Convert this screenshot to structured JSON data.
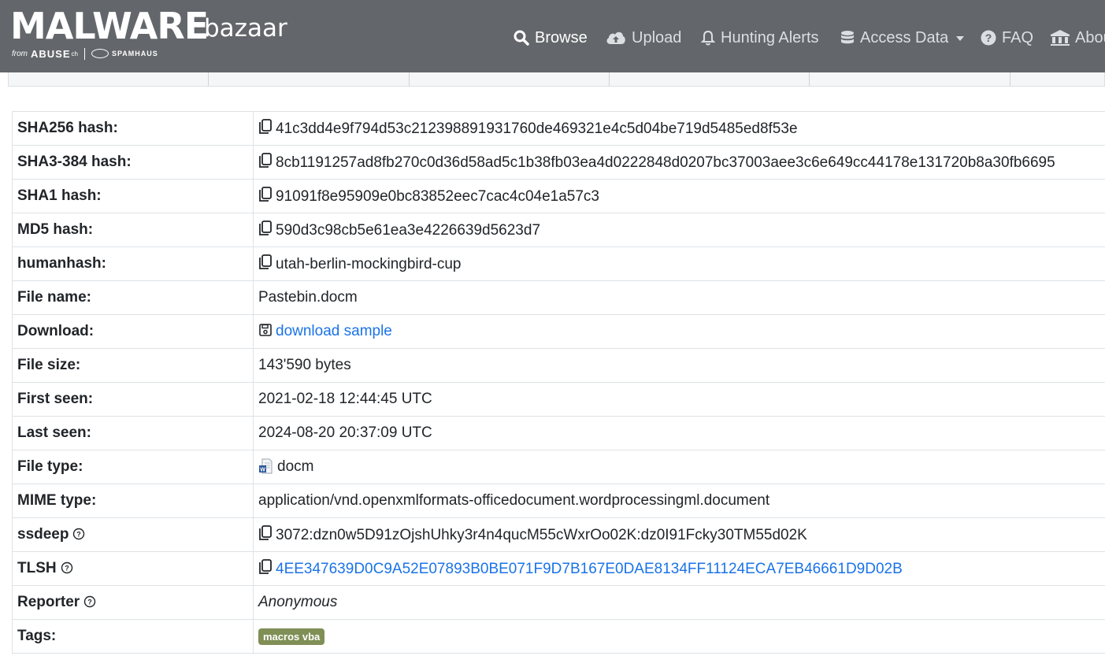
{
  "header": {
    "logo_main": "MALWARE",
    "logo_sub": "bazaar",
    "logo_from": "from",
    "logo_abuse": "ABUSE",
    "logo_ch": "ch",
    "logo_spamhaus": "SPAMHAUS",
    "nav": [
      {
        "label": "Browse",
        "icon": "search-icon",
        "active": true
      },
      {
        "label": "Upload",
        "icon": "cloud-upload-icon"
      },
      {
        "label": "Hunting Alerts",
        "icon": "bell-icon"
      },
      {
        "label": "Access Data",
        "icon": "database-icon"
      },
      {
        "label": "FAQ",
        "icon": "question-circle-icon"
      },
      {
        "label": "About",
        "icon": "building-icon"
      }
    ]
  },
  "rows": {
    "sha256": {
      "key": "SHA256 hash:",
      "value": "41c3dd4e9f794d53c212398891931760de469321e4c5d04be719d5485ed8f53e"
    },
    "sha3": {
      "key": "SHA3-384 hash:",
      "value": "8cb1191257ad8fb270c0d36d58ad5c1b38fb03ea4d0222848d0207bc37003aee3c6e649cc44178e131720b8a30fb6695"
    },
    "sha1": {
      "key": "SHA1 hash:",
      "value": "91091f8e95909e0bc83852eec7cac4c04e1a57c3"
    },
    "md5": {
      "key": "MD5 hash:",
      "value": "590d3c98cb5e61ea3e4226639d5623d7"
    },
    "humanhash": {
      "key": "humanhash:",
      "value": "utah-berlin-mockingbird-cup"
    },
    "filename": {
      "key": "File name:",
      "value": "Pastebin.docm"
    },
    "download": {
      "key": "Download:",
      "value": "download sample"
    },
    "filesize": {
      "key": "File size:",
      "value": "143'590 bytes"
    },
    "firstseen": {
      "key": "First seen:",
      "value": "2021-02-18 12:44:45 UTC"
    },
    "lastseen": {
      "key": "Last seen:",
      "value": "2024-08-20 20:37:09 UTC"
    },
    "filetype": {
      "key": "File type:",
      "value": "docm"
    },
    "mime": {
      "key": "MIME type:",
      "value": "application/vnd.openxmlformats-officedocument.wordprocessingml.document"
    },
    "ssdeep": {
      "key": "ssdeep",
      "value": "3072:dzn0w5D91zOjshUhky3r4n4qucM55cWxrOo02K:dz0I91Fcky30TM55d02K"
    },
    "tlsh": {
      "key": "TLSH",
      "value": "4EE347639D0C9A52E07893B0BE071F9D7B167E0DAE8134FF11124ECA7EB46661D9D02B"
    },
    "reporter": {
      "key": "Reporter",
      "value": "Anonymous"
    },
    "tags": {
      "key": "Tags:",
      "value": "macros vba"
    }
  },
  "colors": {
    "navbar": "#63666a",
    "link": "#1a73e8",
    "tag": "#7f8f55"
  }
}
